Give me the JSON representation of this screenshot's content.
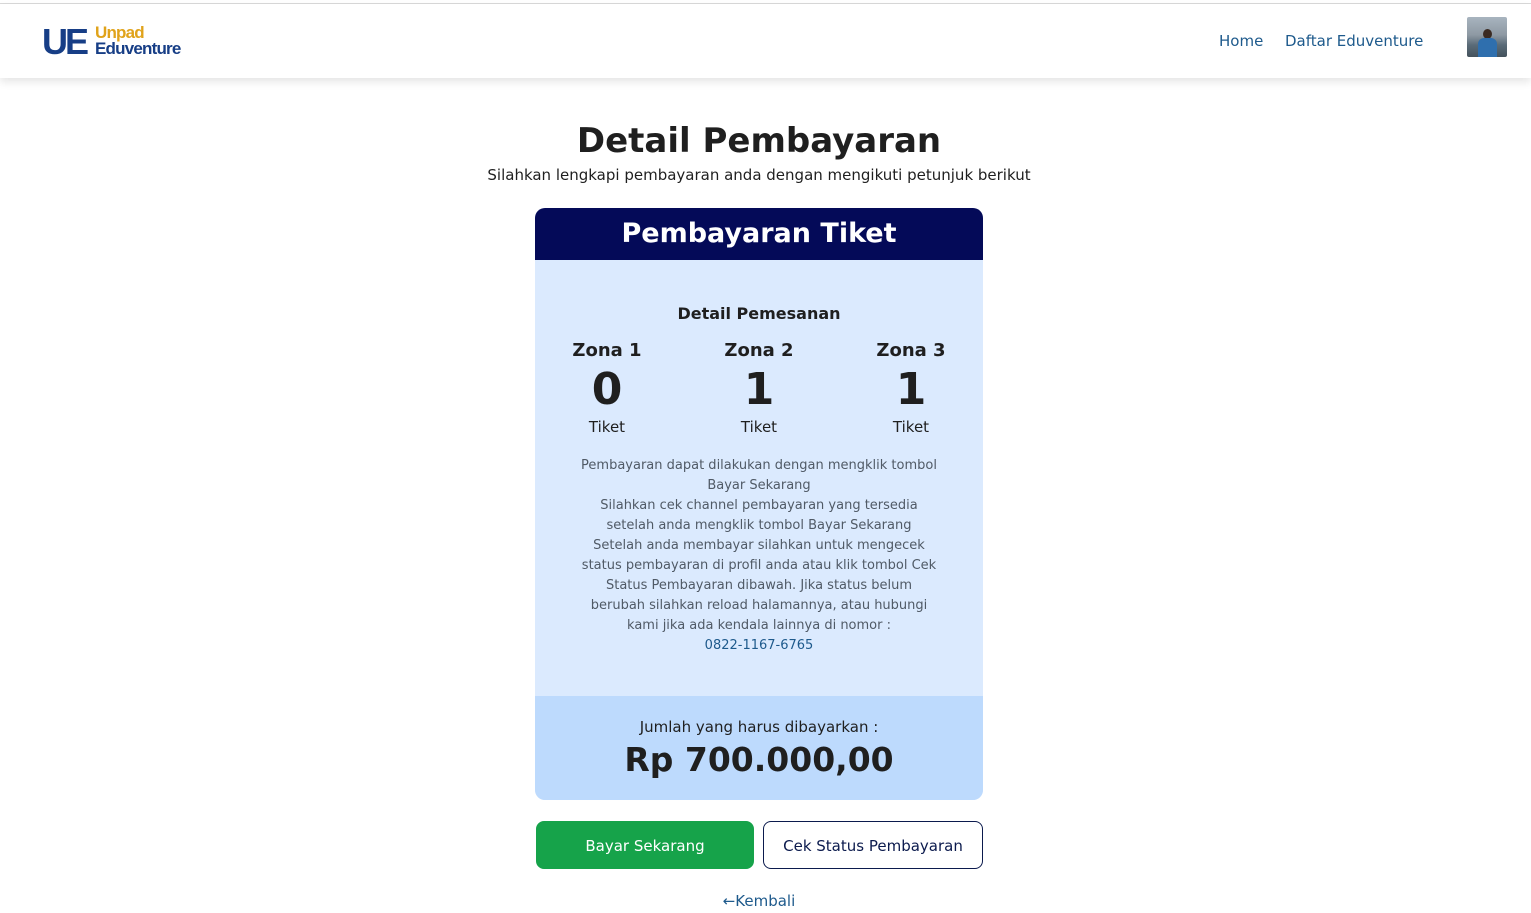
{
  "navbar": {
    "logo_mark": "UE",
    "logo_word_1": "Unpad",
    "logo_word_2": "Eduventure",
    "links": [
      {
        "label": "Home"
      },
      {
        "label": "Daftar Eduventure"
      }
    ]
  },
  "page": {
    "title": "Detail Pembayaran",
    "subtitle": "Silahkan lengkapi pembayaran anda dengan mengikuti petunjuk berikut"
  },
  "card": {
    "header": "Pembayaran Tiket",
    "section_title": "Detail Pemesanan",
    "zones": [
      {
        "name": "Zona 1",
        "count": "0",
        "unit": "Tiket"
      },
      {
        "name": "Zona 2",
        "count": "1",
        "unit": "Tiket"
      },
      {
        "name": "Zona 3",
        "count": "1",
        "unit": "Tiket"
      }
    ],
    "instructions": {
      "line_1": "Pembayaran dapat dilakukan dengan mengklik tombol Bayar Sekarang",
      "line_2": "Silahkan cek channel pembayaran yang tersedia setelah anda mengklik tombol Bayar Sekarang",
      "line_3": "Setelah anda membayar silahkan untuk mengecek status pembayaran di profil anda atau klik tombol Cek Status Pembayaran dibawah. Jika status belum berubah silahkan reload halamannya, atau hubungi kami jika ada kendala lainnya di nomor :",
      "phone": "0822-1167-6765"
    },
    "total_label": "Jumlah yang harus dibayarkan :",
    "total_amount": "Rp 700.000,00"
  },
  "actions": {
    "pay_label": "Bayar Sekarang",
    "status_label": "Cek Status Pembayaran",
    "back_label": "←Kembali"
  },
  "colors": {
    "header_navy": "#040a58",
    "card_bg": "#dbeafe",
    "total_bg": "#bddafd",
    "pay_green": "#16a34a",
    "link_blue": "#1e5a8c"
  }
}
